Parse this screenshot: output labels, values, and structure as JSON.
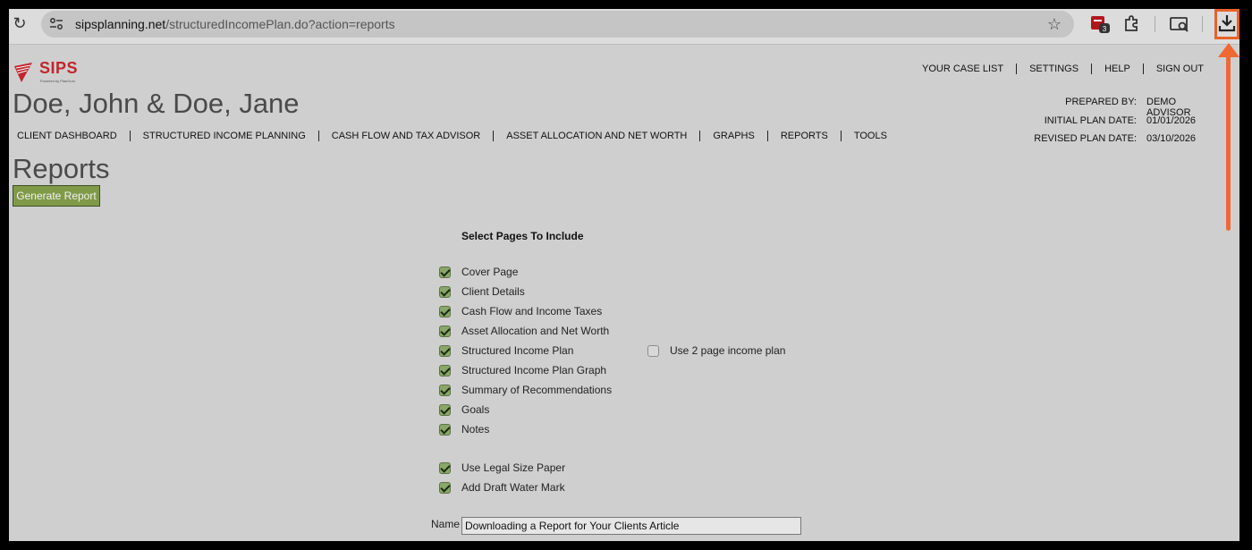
{
  "browser": {
    "url_host": "sipsplanning.net",
    "url_path": "/structuredIncomePlan.do?action=reports",
    "extension_badge": "3"
  },
  "brand": {
    "logo_text": "SIPS",
    "logo_subtext": "Powered by PlanGuru",
    "accent_color": "#c0262d",
    "highlight_color": "#e8622a"
  },
  "top_nav": [
    "YOUR CASE LIST",
    "SETTINGS",
    "HELP",
    "SIGN OUT"
  ],
  "client": {
    "name": "Doe, John & Doe, Jane"
  },
  "plan_info": [
    {
      "label": "PREPARED BY:",
      "value": "DEMO ADVISOR"
    },
    {
      "label": "INITIAL PLAN DATE:",
      "value": "01/01/2026"
    },
    {
      "label": "REVISED PLAN DATE:",
      "value": "03/10/2026"
    }
  ],
  "main_nav": [
    "CLIENT DASHBOARD",
    "STRUCTURED INCOME PLANNING",
    "CASH FLOW AND TAX ADVISOR",
    "ASSET ALLOCATION AND NET WORTH",
    "GRAPHS",
    "REPORTS",
    "TOOLS"
  ],
  "page": {
    "title": "Reports",
    "generate_button": "Generate Report",
    "section_heading": "Select Pages To Include"
  },
  "options": [
    {
      "label": "Cover Page",
      "checked": true
    },
    {
      "label": "Client Details",
      "checked": true
    },
    {
      "label": "Cash Flow and Income Taxes",
      "checked": true
    },
    {
      "label": "Asset Allocation and Net Worth",
      "checked": true
    },
    {
      "label": "Structured Income Plan",
      "checked": true
    },
    {
      "label": "Structured Income Plan Graph",
      "checked": true
    },
    {
      "label": "Summary of Recommendations",
      "checked": true
    },
    {
      "label": "Goals",
      "checked": true
    },
    {
      "label": "Notes",
      "checked": true
    },
    {
      "label": "Use Legal Size Paper",
      "checked": true
    },
    {
      "label": "Add Draft Water Mark",
      "checked": true
    }
  ],
  "two_page_option": {
    "label": "Use 2 page income plan",
    "checked": false
  },
  "name_field": {
    "label": "Name",
    "value": "Downloading a Report for Your Clients Article"
  }
}
